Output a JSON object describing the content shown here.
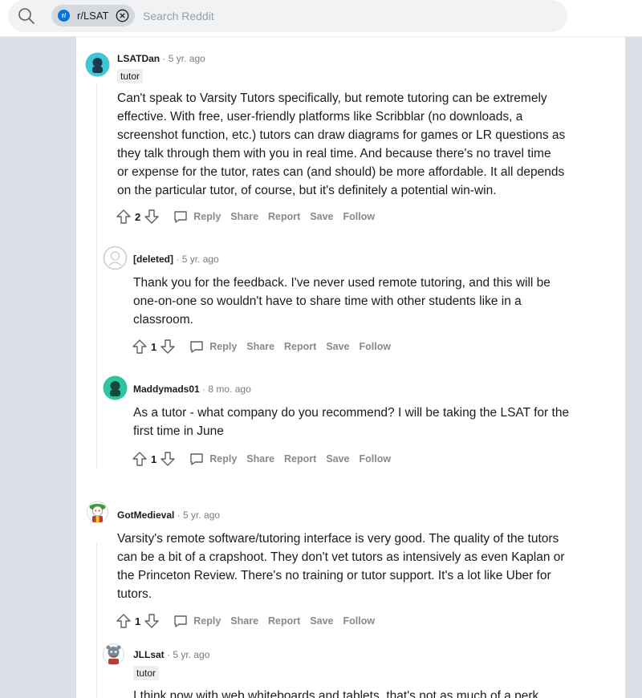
{
  "header": {
    "search_icon": "search-icon",
    "community_chip": {
      "icon": "subreddit-icon",
      "icon_text": "r/",
      "label": "r/LSAT",
      "close_icon": "close-circle-icon"
    },
    "search_placeholder": "Search Reddit"
  },
  "actions": {
    "reply": "Reply",
    "share": "Share",
    "report": "Report",
    "save": "Save",
    "follow": "Follow"
  },
  "comments": [
    {
      "author": "LSATDan",
      "age": "5 yr. ago",
      "flair": "tutor",
      "lines": [
        "Can't speak to Varsity Tutors specifically, but remote tutoring can be extremely",
        "effective. With free, user-friendly platforms like Scribblar (no downloads, a",
        "screenshot function, etc.) tutors can draw diagrams for games or LR questions as",
        "they talk through them with you in real time. And because there's no travel time",
        "or expense for the tutor, rates can (and should) be more affordable. It all depends",
        "on the particular tutor, of course, but it's definitely a potential win-win."
      ],
      "score": "2"
    },
    {
      "author": "[deleted]",
      "age": "5 yr. ago",
      "lines": [
        "Thank you for the feedback. I've never used remote tutoring, and this will be",
        "one-on-one so wouldn't have to share time with other students like in a",
        "classroom."
      ],
      "score": "1"
    },
    {
      "author": "Maddymads01",
      "age": "8 mo. ago",
      "lines": [
        "As a tutor - what company do you recommend? I will be taking the LSAT for the",
        "first time in June"
      ],
      "score": "1"
    },
    {
      "author": "GotMedieval",
      "age": "5 yr. ago",
      "lines": [
        "Varsity's remote software/tutoring interface is very good. The quality of the tutors",
        "can be a bit of a crapshoot. They don't vet tutors as intensively as even Kaplan or",
        "the Princeton Review. There's no training or tutor support. It's a lot like Uber for",
        "tutors."
      ],
      "score": "1"
    },
    {
      "author": "JLLsat",
      "age": "5 yr. ago",
      "flair": "tutor",
      "lines": [
        "I think now with web whiteboards and tablets, that's not as much of a perk"
      ]
    }
  ],
  "colors": {
    "accent": "#0a72d8",
    "page_bg": "#dae0e6",
    "muted": "#878a8c",
    "avatar_teal": "#3fc7d6",
    "avatar_green": "#2ec4a0"
  }
}
